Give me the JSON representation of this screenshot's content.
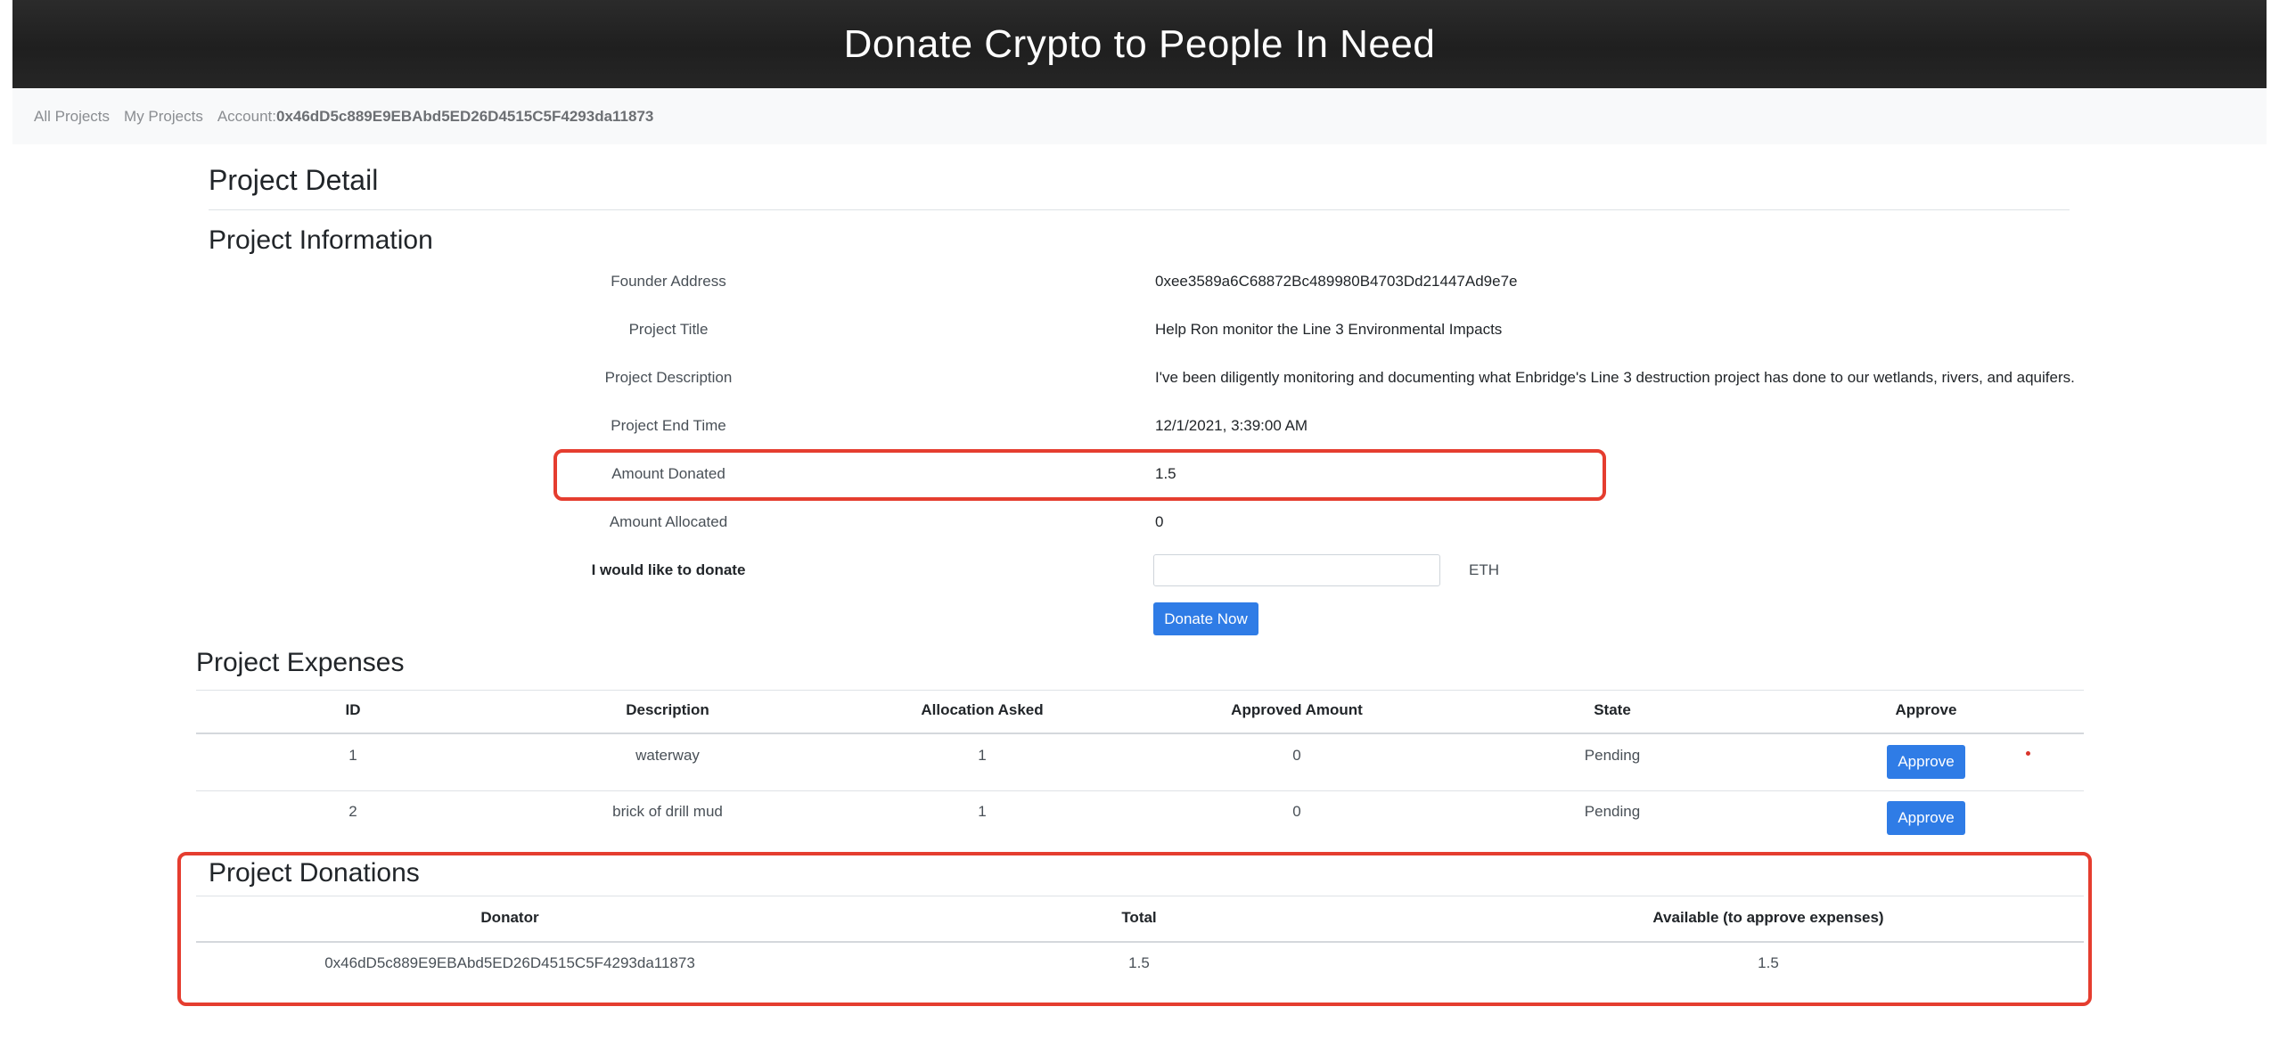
{
  "header": {
    "title": "Donate Crypto to People In Need"
  },
  "nav": {
    "all_projects": "All Projects",
    "my_projects": "My Projects",
    "account_label": "Account:",
    "account_value": "0x46dD5c889E9EBAbd5ED26D4515C5F4293da11873"
  },
  "page_title": "Project Detail",
  "info": {
    "title": "Project Information",
    "rows": [
      {
        "label": "Founder Address",
        "value": "0xee3589a6C68872Bc489980B4703Dd21447Ad9e7e"
      },
      {
        "label": "Project Title",
        "value": "Help Ron monitor the Line 3 Environmental Impacts"
      },
      {
        "label": "Project Description",
        "value": "I've been diligently monitoring and documenting what Enbridge's Line 3 destruction project has done to our wetlands, rivers, and aquifers."
      },
      {
        "label": "Project End Time",
        "value": "12/1/2021, 3:39:00 AM"
      },
      {
        "label": "Amount Donated",
        "value": "1.5"
      },
      {
        "label": "Amount Allocated",
        "value": "0"
      }
    ],
    "donate_label": "I would like to donate",
    "donate_input_value": "",
    "donate_unit": "ETH",
    "donate_button": "Donate Now"
  },
  "expenses": {
    "title": "Project Expenses",
    "columns": [
      "ID",
      "Description",
      "Allocation Asked",
      "Approved Amount",
      "State",
      "Approve"
    ],
    "rows": [
      {
        "id": "1",
        "description": "waterway",
        "allocation": "1",
        "approved": "0",
        "state": "Pending",
        "action": "Approve"
      },
      {
        "id": "2",
        "description": "brick of drill mud",
        "allocation": "1",
        "approved": "0",
        "state": "Pending",
        "action": "Approve"
      }
    ]
  },
  "donations": {
    "title": "Project Donations",
    "columns": [
      "Donator",
      "Total",
      "Available (to approve expenses)"
    ],
    "rows": [
      {
        "donator": "0x46dD5c889E9EBAbd5ED26D4515C5F4293da11873",
        "total": "1.5",
        "available": "1.5"
      }
    ]
  },
  "colors": {
    "accent": "#2f7ce6",
    "highlight": "#e53d2f",
    "header_bg": "#222222"
  }
}
